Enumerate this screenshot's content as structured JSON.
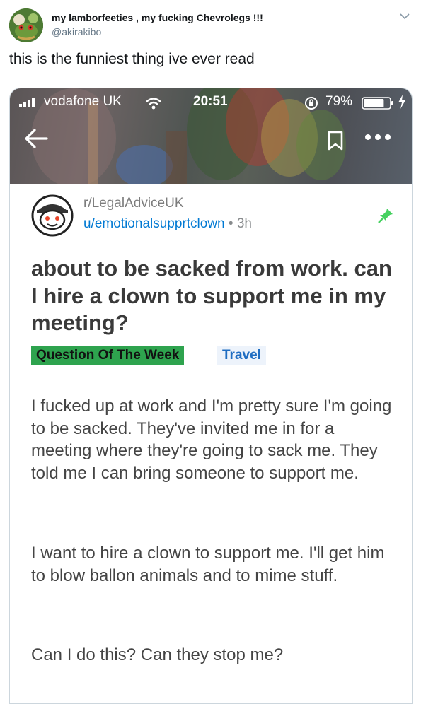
{
  "tweet": {
    "display_name": "my lamborfeeties , my fucking Chevrolegs !!!",
    "handle": "@akirakibo",
    "text": "this is the funniest thing ive ever read",
    "avatar_icon": "frog-avatar",
    "menu_icon": "chevron-down-icon"
  },
  "screenshot": {
    "status_bar": {
      "carrier": "vodafone UK",
      "time": "20:51",
      "battery": "79%",
      "battery_level": 0.79
    },
    "post": {
      "subreddit": "r/LegalAdviceUK",
      "author": "u/emotionalsupprtclown",
      "separator": "•",
      "age": "3h",
      "title": "about to be sacked from work. can I hire a clown to support me in my meeting?",
      "flairs": [
        "Question Of The Week",
        "Travel"
      ],
      "body": [
        "I fucked up at work and I'm pretty sure I'm going to be sacked. They've invited me in for a meeting where they're going to sack me. They told me I can bring someone to support me.",
        "I want to hire a clown to support me. I'll get him to blow ballon animals and to mime stuff.",
        "Can I do this? Can they stop me?"
      ]
    }
  },
  "colors": {
    "reddit_blue": "#0079d3",
    "flair_green": "#2ea34e",
    "pin_green": "#46d160"
  }
}
